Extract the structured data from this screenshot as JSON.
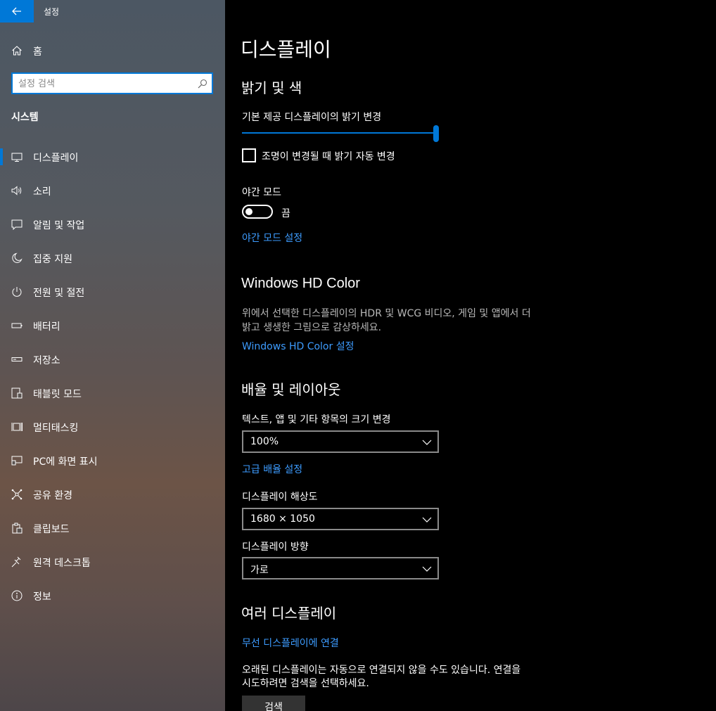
{
  "window": {
    "title": "설정"
  },
  "sidebar": {
    "home_label": "홈",
    "search": {
      "placeholder": "설정 검색",
      "value": ""
    },
    "section_title": "시스템",
    "items": [
      {
        "label": "디스플레이",
        "icon": "monitor-icon",
        "active": true
      },
      {
        "label": "소리",
        "icon": "speaker-icon"
      },
      {
        "label": "알림 및 작업",
        "icon": "notification-icon"
      },
      {
        "label": "집중 지원",
        "icon": "moon-icon"
      },
      {
        "label": "전원 및 절전",
        "icon": "power-icon"
      },
      {
        "label": "배터리",
        "icon": "battery-icon"
      },
      {
        "label": "저장소",
        "icon": "storage-icon"
      },
      {
        "label": "태블릿 모드",
        "icon": "tablet-icon"
      },
      {
        "label": "멀티태스킹",
        "icon": "multitasking-icon"
      },
      {
        "label": "PC에 화면 표시",
        "icon": "project-icon"
      },
      {
        "label": "공유 환경",
        "icon": "shared-experiences-icon"
      },
      {
        "label": "클립보드",
        "icon": "clipboard-icon"
      },
      {
        "label": "원격 데스크톱",
        "icon": "remote-desktop-icon"
      },
      {
        "label": "정보",
        "icon": "info-icon"
      }
    ]
  },
  "main": {
    "page_title": "디스플레이",
    "brightness": {
      "heading": "밝기 및 색",
      "slider_label": "기본 제공 디스플레이의 밝기 변경",
      "slider_value_percent": 100,
      "auto_checkbox_label": "조명이 변경될 때 밝기 자동 변경",
      "auto_checked": false,
      "night_light_label": "야간 모드",
      "night_light_state": "끔",
      "night_light_on": false,
      "night_light_link": "야간 모드 설정"
    },
    "hdr": {
      "heading": "Windows HD Color",
      "desc_line1": "위에서 선택한 디스플레이의 HDR 및 WCG 비디오, 게임 및 앱에서 더",
      "desc_line2": "밝고 생생한 그림으로 감상하세요.",
      "link": "Windows HD Color 설정"
    },
    "scale": {
      "heading": "배율 및 레이아웃",
      "size_label": "텍스트, 앱 및 기타 항목의 크기 변경",
      "size_value": "100%",
      "advanced_link": "고급 배율 설정",
      "resolution_label": "디스플레이 해상도",
      "resolution_value": "1680 × 1050",
      "orientation_label": "디스플레이 방향",
      "orientation_value": "가로"
    },
    "multi": {
      "heading": "여러 디스플레이",
      "wireless_link": "무선 디스플레이에 연결",
      "desc_line1": "오래된 디스플레이는 자동으로 연결되지 않을 수도 있습니다. 연결을",
      "desc_line2": "시도하려면 검색을 선택하세요.",
      "detect_button": "검색"
    }
  },
  "colors": {
    "accent": "#0078d7",
    "link": "#3d9cff"
  }
}
